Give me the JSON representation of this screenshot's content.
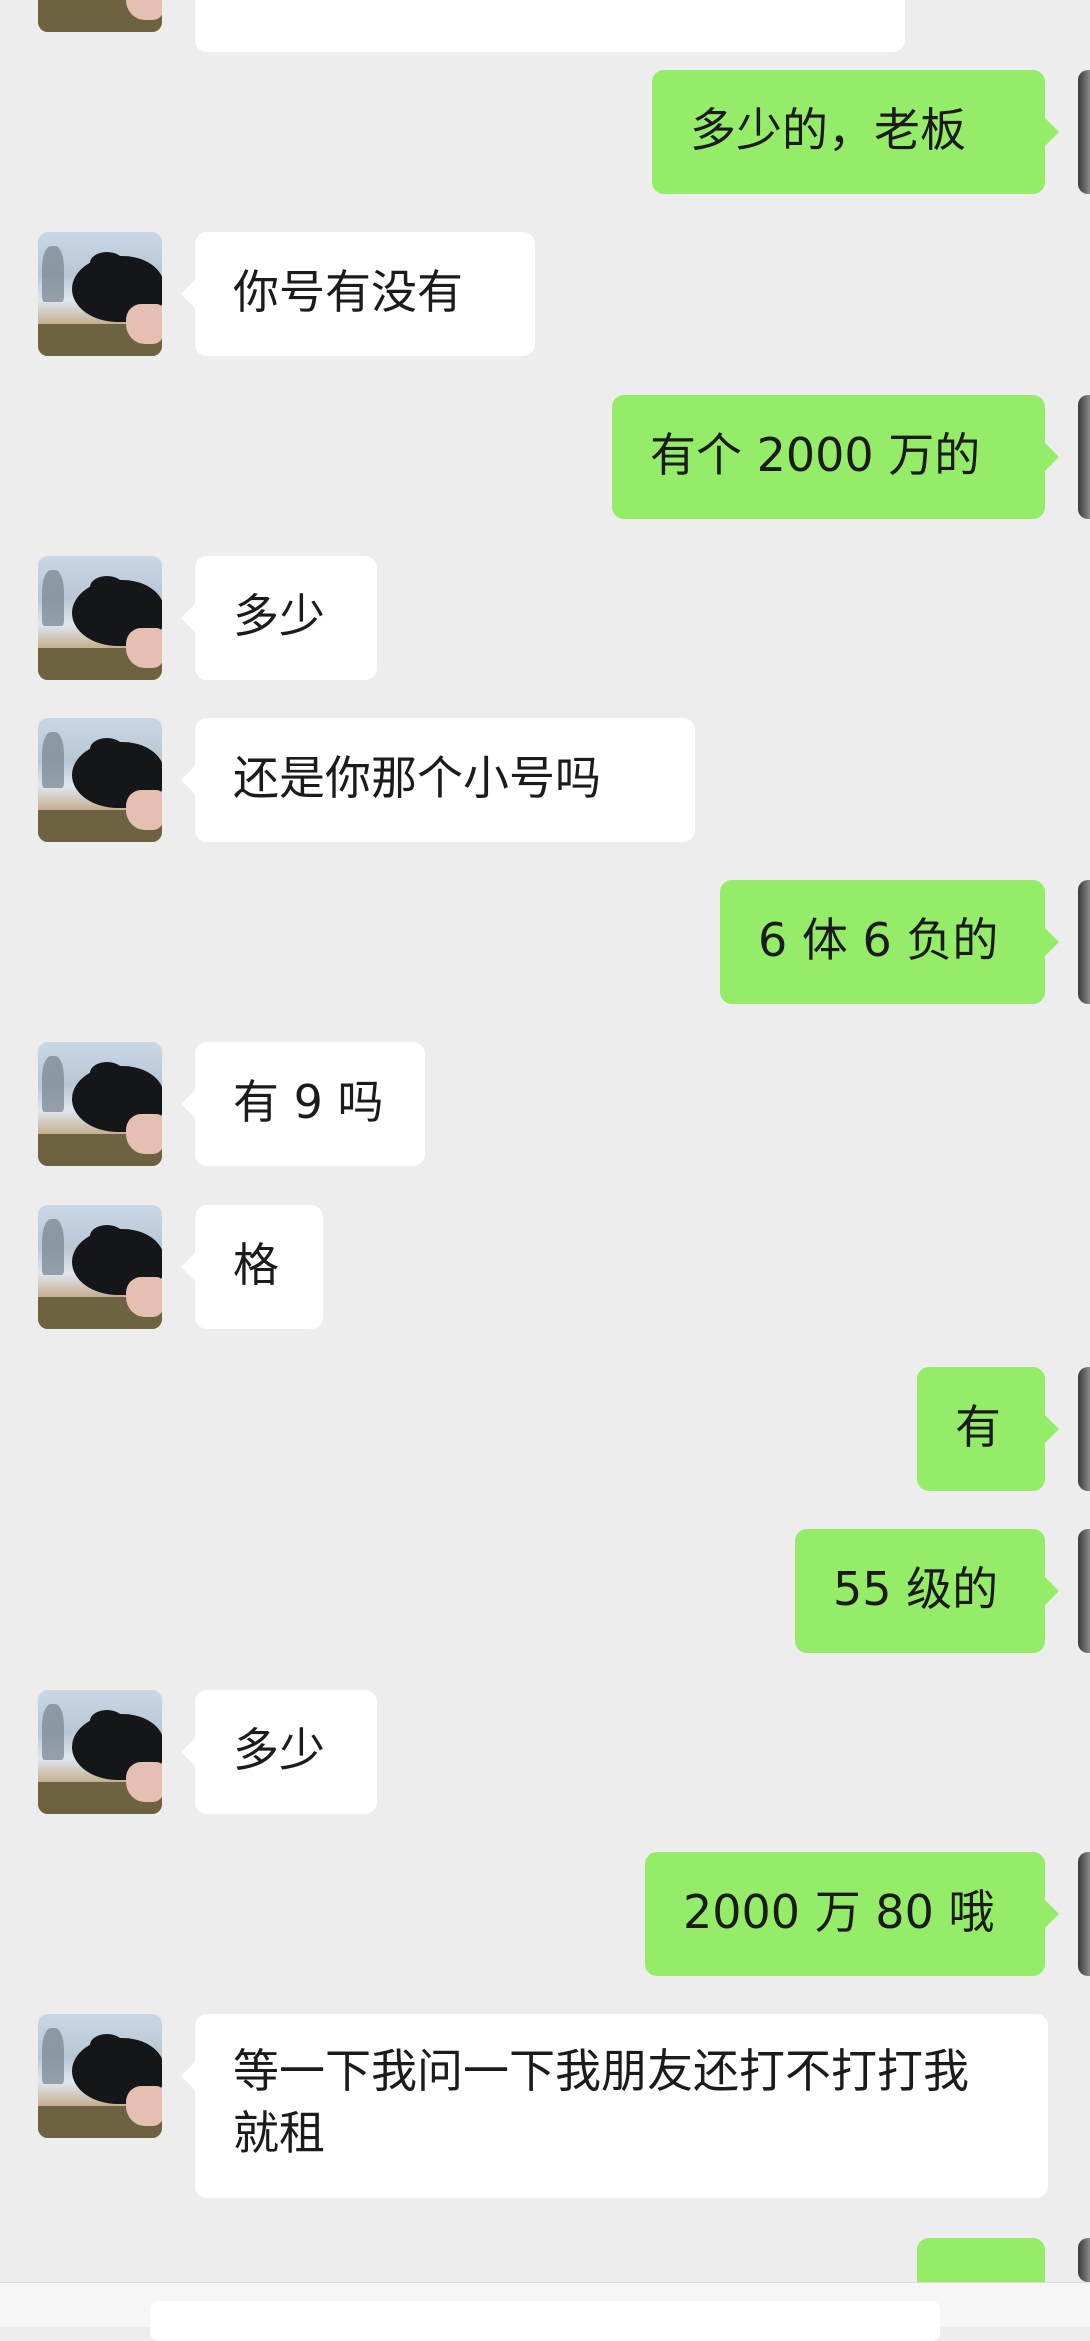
{
  "messages": [
    {
      "side": "in",
      "text": ""
    },
    {
      "side": "out",
      "text": "多少的，老板"
    },
    {
      "side": "in",
      "text": "你号有没有"
    },
    {
      "side": "out",
      "text": "有个 2000 万的"
    },
    {
      "side": "in",
      "text": "多少"
    },
    {
      "side": "in",
      "text": "还是你那个小号吗"
    },
    {
      "side": "out",
      "text": "6 体 6 负的"
    },
    {
      "side": "in",
      "text": "有 9 吗"
    },
    {
      "side": "in",
      "text": "格"
    },
    {
      "side": "out",
      "text": "有"
    },
    {
      "side": "out",
      "text": "55 级的"
    },
    {
      "side": "in",
      "text": "多少"
    },
    {
      "side": "out",
      "text": "2000 万 80 哦"
    },
    {
      "side": "in",
      "text": "等一下我问一下我朋友还打不打打我就租"
    },
    {
      "side": "out",
      "text": ""
    }
  ],
  "colors": {
    "background": "#ededed",
    "incoming_bubble": "#ffffff",
    "outgoing_bubble": "#95ec69"
  },
  "icons": {
    "contact_avatar": "avatar-dog-photo",
    "own_avatar": "avatar-self"
  }
}
